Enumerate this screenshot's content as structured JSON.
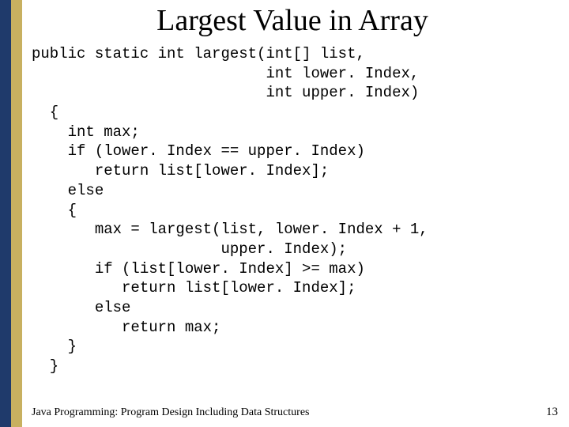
{
  "title": "Largest Value in Array",
  "code": "public static int largest(int[] list,\n                          int lower. Index,\n                          int upper. Index)\n  {\n    int max;\n    if (lower. Index == upper. Index)\n       return list[lower. Index];\n    else\n    {\n       max = largest(list, lower. Index + 1,\n                     upper. Index);\n       if (list[lower. Index] >= max)\n          return list[lower. Index];\n       else\n          return max;\n    }\n  }",
  "footer_left": "Java Programming: Program Design Including Data Structures",
  "footer_right": "13"
}
